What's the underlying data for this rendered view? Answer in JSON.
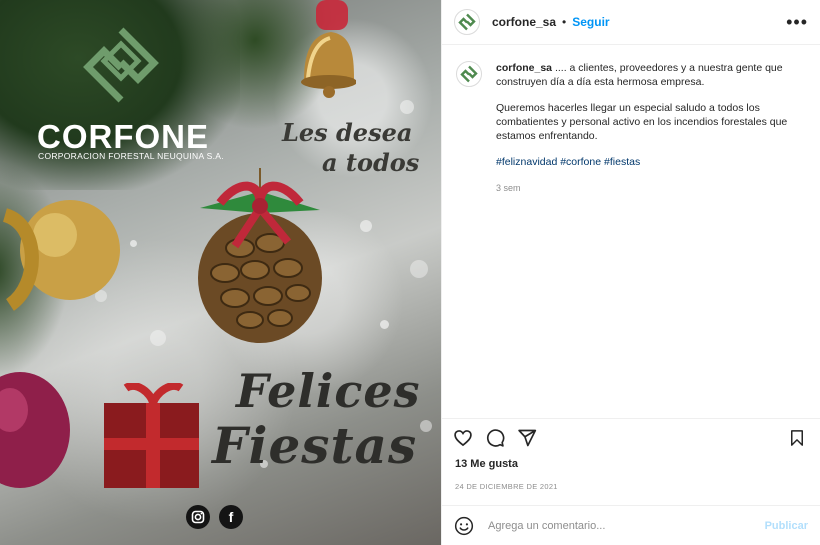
{
  "image": {
    "brand_name": "CORFONE",
    "brand_subtitle": "CORPORACION FORESTAL NEUQUINA S.A.",
    "greeting_line1": "Les desea",
    "greeting_line2": "a todos",
    "felices": "Felices",
    "fiestas": "Fiestas",
    "social_icons": [
      "instagram-icon",
      "facebook-icon"
    ],
    "facebook_glyph": "f"
  },
  "header": {
    "username": "corfone_sa",
    "separator": "•",
    "follow_label": "Seguir",
    "more_icon": "more-options-icon",
    "more_glyph": "•••"
  },
  "caption": {
    "username": "corfone_sa",
    "text_line1": ".... a clientes, proveedores y a nuestra gente que construyen día a día esta hermosa empresa.",
    "text_line2": "Queremos hacerles llegar un especial saludo a todos los combatientes y personal activo en los incendios forestales que estamos enfrentando.",
    "hashtags": [
      "#feliznavidad",
      "#corfone",
      "#fiestas"
    ],
    "time_ago": "3 sem"
  },
  "actions": {
    "icons": [
      "heart-icon",
      "comment-icon",
      "share-icon",
      "bookmark-icon"
    ]
  },
  "likes_label": "13 Me gusta",
  "post_date": "24 DE DICIEMBRE DE 2021",
  "comment_box": {
    "placeholder": "Agrega un comentario...",
    "publish_label": "Publicar",
    "emoji_icon": "emoji-icon"
  },
  "colors": {
    "brand_green": "#4f8a4f",
    "link_blue": "#0095f6",
    "hashtag_blue": "#00376b",
    "publish_disabled": "#b2dffc",
    "muted_text": "#8e8e8e"
  }
}
